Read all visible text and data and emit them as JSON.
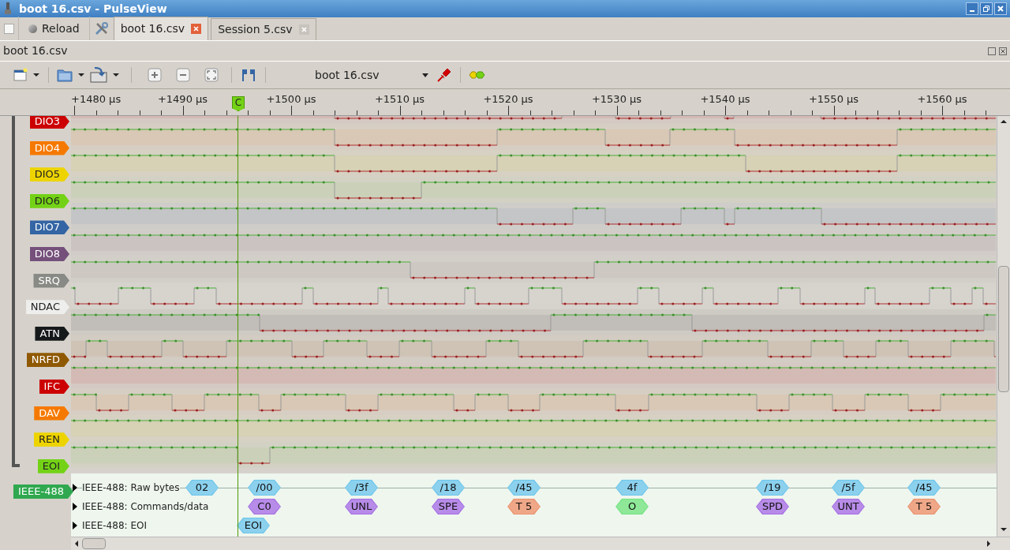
{
  "window": {
    "title": "boot 16.csv - PulseView"
  },
  "session_bar": {
    "reload": "Reload"
  },
  "tabs": [
    {
      "label": "boot 16.csv",
      "selected": true
    },
    {
      "label": "Session 5.csv",
      "selected": false
    }
  ],
  "dock": {
    "title": "boot 16.csv"
  },
  "toolbar": {
    "device": "boot 16.csv"
  },
  "ruler": {
    "ticks": [
      "+1480 µs",
      "+1490 µs",
      "+1500 µs",
      "+1510 µs",
      "+1520 µs",
      "+1530 µs",
      "+1540 µs",
      "+1550 µs",
      "+1560 µs"
    ],
    "cursor": "C"
  },
  "signals": [
    {
      "name": "DIO3",
      "color": "#cc0000"
    },
    {
      "name": "DIO4",
      "color": "#f57900"
    },
    {
      "name": "DIO5",
      "color": "#edd400"
    },
    {
      "name": "DIO6",
      "color": "#73d216"
    },
    {
      "name": "DIO7",
      "color": "#3465a4"
    },
    {
      "name": "DIO8",
      "color": "#75507b"
    },
    {
      "name": "SRQ",
      "color": "#888a85"
    },
    {
      "name": "NDAC",
      "color": "#eeeeec"
    },
    {
      "name": "ATN",
      "color": "#16191a"
    },
    {
      "name": "NRFD",
      "color": "#8f5902"
    },
    {
      "name": "IFC",
      "color": "#cc0000"
    },
    {
      "name": "DAV",
      "color": "#f57900"
    },
    {
      "name": "REN",
      "color": "#edd400"
    },
    {
      "name": "EOI",
      "color": "#73d216"
    }
  ],
  "decoder": {
    "name": "IEEE-488",
    "color": "#2fa84f",
    "rows": [
      {
        "label": "IEEE-488: Raw bytes",
        "annotations": [
          {
            "text": "02",
            "color": "#6ec6ea"
          },
          {
            "text": "/00",
            "color": "#6ec6ea"
          },
          {
            "text": "/3f",
            "color": "#6ec6ea"
          },
          {
            "text": "/18",
            "color": "#6ec6ea"
          },
          {
            "text": "/45",
            "color": "#6ec6ea"
          },
          {
            "text": "4f",
            "color": "#6ec6ea"
          },
          {
            "text": "/19",
            "color": "#6ec6ea"
          },
          {
            "text": "/5f",
            "color": "#6ec6ea"
          },
          {
            "text": "/45",
            "color": "#6ec6ea"
          }
        ]
      },
      {
        "label": "IEEE-488: Commands/data",
        "annotations": [
          {
            "text": "C0",
            "color": "#a66fe3"
          },
          {
            "text": "UNL",
            "color": "#a66fe3"
          },
          {
            "text": "SPE",
            "color": "#a66fe3"
          },
          {
            "text": "T 5",
            "color": "#eb916b"
          },
          {
            "text": "O",
            "color": "#72e37f"
          },
          {
            "text": "SPD",
            "color": "#a66fe3"
          },
          {
            "text": "UNT",
            "color": "#a66fe3"
          },
          {
            "text": "T 5",
            "color": "#eb916b"
          }
        ]
      },
      {
        "label": "IEEE-488: EOI",
        "annotations": [
          {
            "text": "EOI",
            "color": "#6ec6ea"
          }
        ]
      }
    ]
  }
}
